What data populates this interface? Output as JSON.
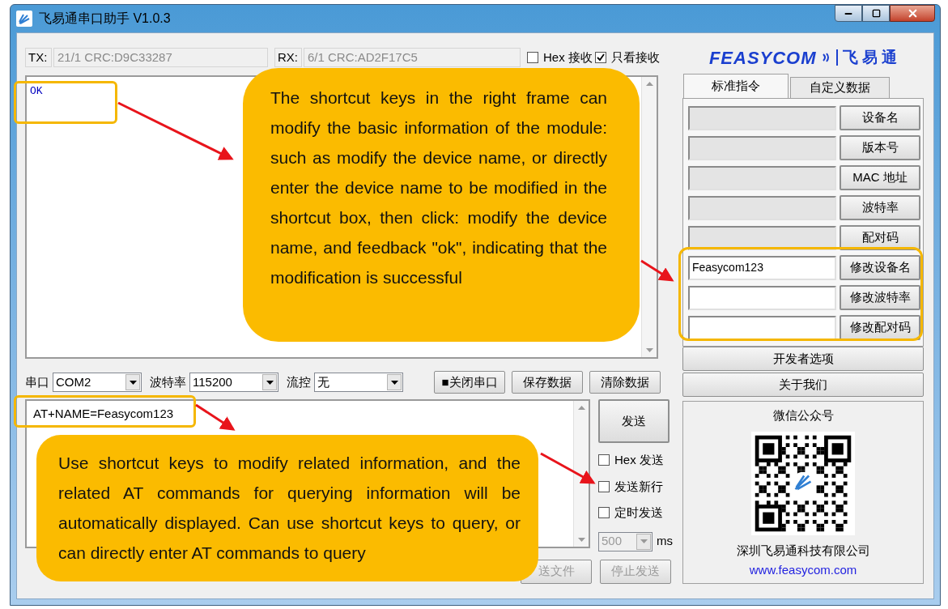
{
  "window": {
    "title": "飞易通串口助手 V1.0.3"
  },
  "counters": {
    "tx_label": "TX:",
    "tx_value": "21/1 CRC:D9C33287",
    "rx_label": "RX:",
    "rx_value": "6/1 CRC:AD2F17C5"
  },
  "receive_options": [
    {
      "label": "Hex 接收",
      "checked": false
    },
    {
      "label": "只看接收",
      "checked": true
    }
  ],
  "receive_area": {
    "text": "OK"
  },
  "serial_settings": [
    {
      "label": "串口",
      "value": "COM2"
    },
    {
      "label": "波特率",
      "value": "115200"
    },
    {
      "label": "流控",
      "value": "无"
    }
  ],
  "serial_buttons": [
    "■关闭串口",
    "保存数据",
    "清除数据"
  ],
  "send_area": {
    "value": "AT+NAME=Feasycom123"
  },
  "send_button": "发送",
  "send_options": [
    {
      "label": "Hex 发送",
      "checked": false
    },
    {
      "label": "发送新行",
      "checked": false
    },
    {
      "label": "定时发送",
      "checked": false
    }
  ],
  "interval": {
    "value": "500",
    "unit": "ms",
    "disabled": true
  },
  "bottom_buttons": [
    {
      "label": "送文件",
      "disabled": true
    },
    {
      "label": "停止发送",
      "disabled": true
    }
  ],
  "brand": {
    "logo": "FEASYCOM",
    "name": "飞 易 通"
  },
  "tabs": [
    {
      "label": "标准指令",
      "selected": true
    },
    {
      "label": "自定义数据",
      "selected": false
    }
  ],
  "commands": [
    {
      "button": "设备名",
      "editable": false
    },
    {
      "button": "版本号",
      "editable": false
    },
    {
      "button": "MAC 地址",
      "editable": false
    },
    {
      "button": "波特率",
      "editable": false
    },
    {
      "button": "配对码",
      "editable": false
    },
    {
      "value": "Feasycom123",
      "button": "修改设备名",
      "editable": true
    },
    {
      "button": "修改波特率",
      "editable": true
    },
    {
      "button": "修改配对码",
      "editable": true
    }
  ],
  "panel_buttons": [
    "开发者选项",
    "关于我们"
  ],
  "wechat": {
    "title": "微信公众号",
    "company": "深圳飞易通科技有限公司",
    "link": "www.feasycom.com"
  },
  "callouts": [
    {
      "text": "The shortcut keys in the right frame can modify the basic information of the module: such as modify the device name, or directly enter the device name to be modified in the shortcut box, then click: modify the device name, and feedback \"ok\", indicating that the modification is successful"
    },
    {
      "text": "Use shortcut keys to modify related information, and the related AT commands for querying information will be automatically displayed. Can use shortcut keys to query, or can directly enter AT commands to query"
    }
  ]
}
